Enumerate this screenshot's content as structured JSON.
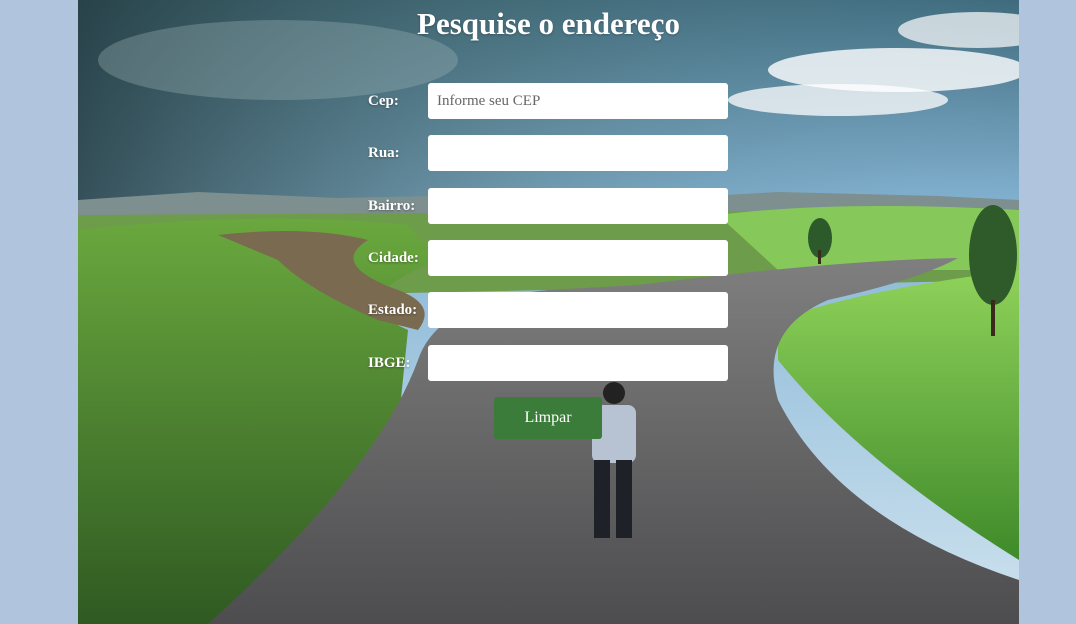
{
  "page": {
    "title": "Pesquise o endereço"
  },
  "form": {
    "fields": [
      {
        "label": "Cep:",
        "value": "",
        "placeholder": "Informe seu CEP"
      },
      {
        "label": "Rua:",
        "value": "",
        "placeholder": ""
      },
      {
        "label": "Bairro:",
        "value": "",
        "placeholder": ""
      },
      {
        "label": "Cidade:",
        "value": "",
        "placeholder": ""
      },
      {
        "label": "Estado:",
        "value": "",
        "placeholder": ""
      },
      {
        "label": "IBGE:",
        "value": "",
        "placeholder": ""
      }
    ],
    "clear_label": "Limpar"
  },
  "colors": {
    "page_background": "#b0c4de",
    "button": "#3b7c3a",
    "text": "#ffffff"
  }
}
